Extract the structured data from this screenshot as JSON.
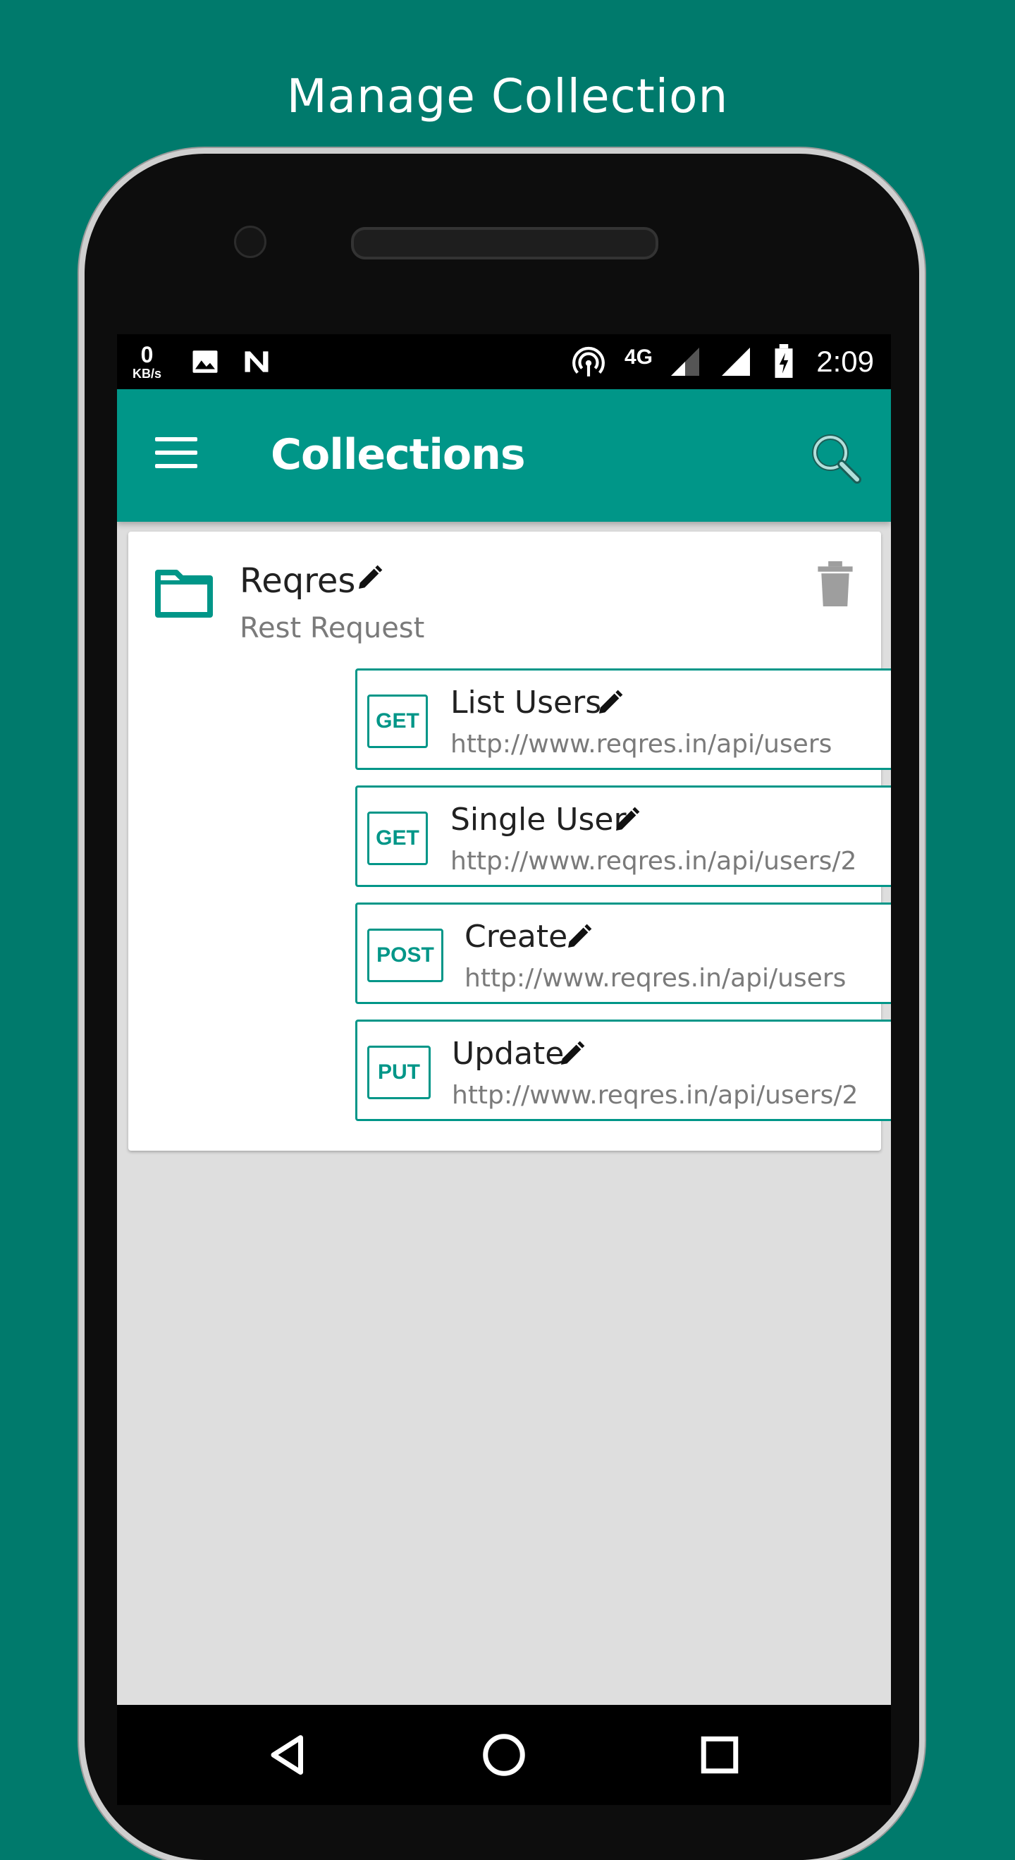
{
  "promo": {
    "title": "Manage Collection"
  },
  "status_bar": {
    "speed_value": "0",
    "speed_unit": "KB/s",
    "network": "4G",
    "time": "2:09"
  },
  "app_bar": {
    "title": "Collections"
  },
  "collection": {
    "name": "Reqres",
    "description": "Rest Request",
    "requests": [
      {
        "method": "GET",
        "name": "List Users",
        "url": "http://www.reqres.in/api/users"
      },
      {
        "method": "GET",
        "name": "Single User",
        "url": "http://www.reqres.in/api/users/2"
      },
      {
        "method": "POST",
        "name": "Create",
        "url": "http://www.reqres.in/api/users"
      },
      {
        "method": "PUT",
        "name": "Update",
        "url": "http://www.reqres.in/api/users/2"
      }
    ]
  },
  "colors": {
    "background": "#007a6c",
    "primary": "#009688",
    "card": "#ffffff",
    "screen": "#dedede",
    "muted_text": "#7a7a7a"
  },
  "icons": {
    "status": [
      "hotspot-icon",
      "network-4g-icon",
      "signal-icon",
      "signal-icon",
      "battery-charging-icon",
      "image-icon",
      "n-icon"
    ],
    "app_bar": [
      "menu-icon",
      "search-icon"
    ],
    "collection": [
      "folder-icon",
      "edit-icon",
      "delete-icon"
    ],
    "nav": [
      "back-icon",
      "home-icon",
      "recents-icon"
    ]
  }
}
